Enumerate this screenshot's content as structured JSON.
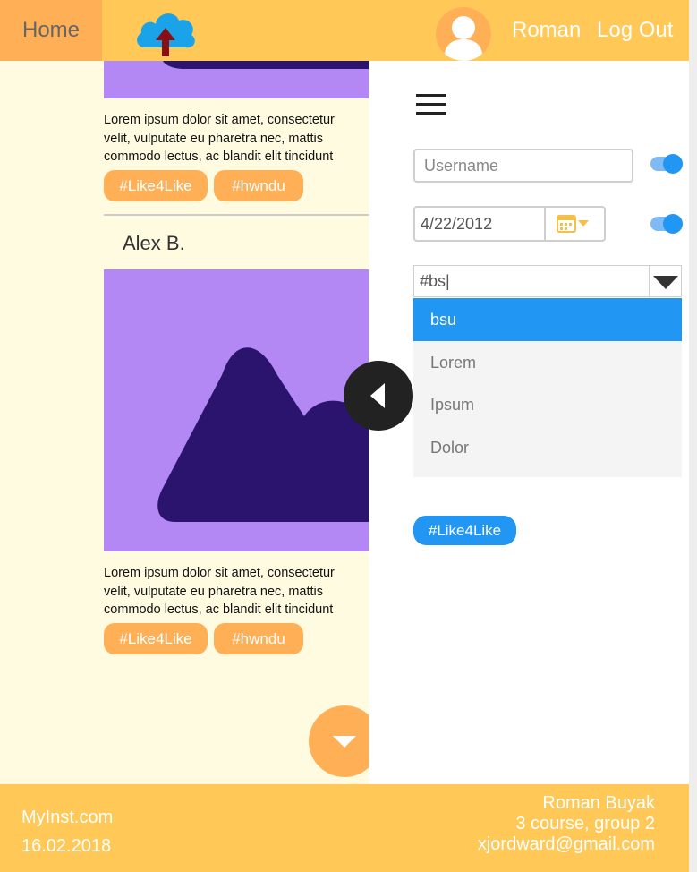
{
  "header": {
    "home_label": "Home",
    "user_name": "Roman",
    "logout_label": "Log Out"
  },
  "feed": {
    "posts": [
      {
        "text_lines": [
          "Lorem ipsum dolor sit amet, consectetur",
          "velit, vulputate eu pharetra nec, mattis",
          "commodo lectus, ac blandit elit tincidunt"
        ],
        "tags": [
          "#Like4Like",
          "#hwndu"
        ]
      },
      {
        "author": "Alex B.",
        "text_lines": [
          "Lorem ipsum dolor sit amet, consectetur",
          "velit, vulputate eu pharetra nec, mattis",
          "commodo lectus, ac blandit elit tincidunt"
        ],
        "tags": [
          "#Like4Like",
          "#hwndu"
        ]
      }
    ]
  },
  "panel": {
    "username_placeholder": "Username",
    "date_value": "4/22/2012",
    "search_value": "#bs|",
    "dropdown_options": [
      "bsu",
      "Lorem",
      "Ipsum",
      "Dolor"
    ],
    "selected_option": "bsu",
    "selected_tags": [
      "#Like4Like"
    ]
  },
  "footer": {
    "site": "MyInst.com",
    "date": "16.02.2018",
    "author_name": "Roman Buyak",
    "author_course": "3 course, group 2",
    "author_email": "xjordward@gmail.com"
  },
  "colors": {
    "header_bg": "#ffc857",
    "accent_orange": "#ffb057",
    "accent_blue": "#2196f3",
    "image_bg": "#b388f5",
    "image_shape": "#2a146e",
    "feed_bg": "#fffbe0"
  }
}
